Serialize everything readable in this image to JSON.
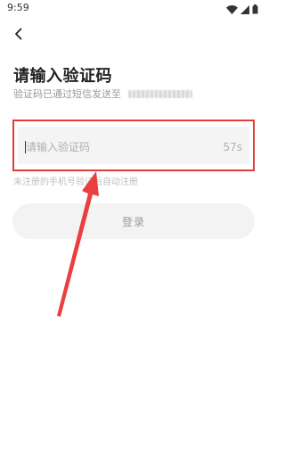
{
  "status_bar": {
    "time": "9:59",
    "icons": [
      "wifi-icon",
      "signal-icon",
      "battery-icon"
    ]
  },
  "header": {
    "back_icon": "chevron-left-icon"
  },
  "page": {
    "title": "请输入验证码",
    "subtitle": "验证码已通过短信发送至"
  },
  "code_input": {
    "placeholder": "请输入验证码",
    "value": "",
    "countdown": "57s"
  },
  "hint": "未注册的手机号验证后自动注册",
  "login_button": {
    "label": "登录",
    "enabled": false
  },
  "colors": {
    "highlight": "#e53a3a",
    "arrow": "#e8403f",
    "input_bg": "#f4f4f4",
    "button_bg": "#f3f3f3",
    "muted_text": "#999999"
  }
}
